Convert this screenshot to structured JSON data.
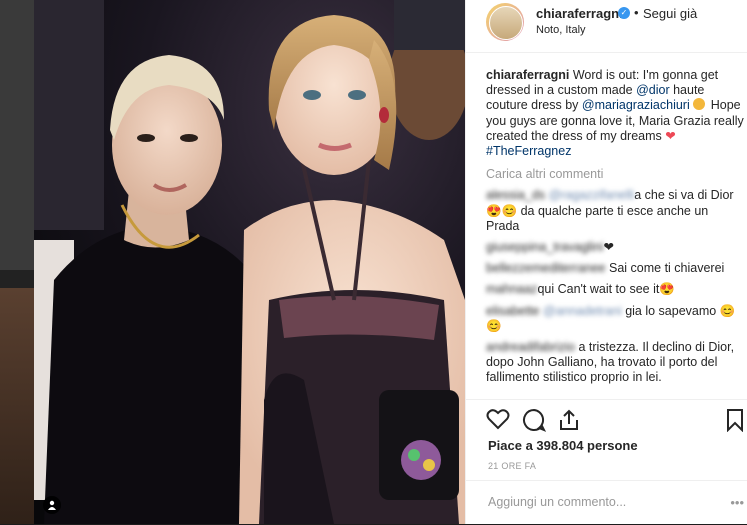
{
  "post": {
    "username": "chiaraferragni",
    "follow_label": "Segui già",
    "separator": "•",
    "location": "Noto, Italy"
  },
  "caption": {
    "user": "chiaraferragni",
    "text_before": " Word is out: I'm gonna get dressed in a custom made ",
    "mention1": "@dior",
    "text_mid": " haute couture dress by ",
    "mention2": "@mariagraziachiuri",
    "text_after": " Hope you guys are gonna love it, Maria Grazia really created the dress of my dreams ",
    "hashtag": "#TheFerragnez"
  },
  "load_more": "Carica altri commenti",
  "comments": [
    {
      "user": "alessia_ds",
      "mention": "@ragazzifanelli",
      "text": "a che si va di Dior 😍😊 da qualche parte ti esce anche un Prada"
    },
    {
      "user": "giuseppina_travaglini",
      "mention": "",
      "text": "❤"
    },
    {
      "user": "bellezzemediterranee",
      "mention": "",
      "text": "Sai come ti chiaverei"
    },
    {
      "user": "mahnaaz",
      "mention": "",
      "text": "qui Can't wait to see it😍"
    },
    {
      "user": "elisabette",
      "mention": "@annadetrani",
      "text": "gia lo sapevamo 😊😊"
    },
    {
      "user": "andreadifabrizio",
      "mention": "",
      "text": "a tristezza. Il declino di Dior, dopo John Galliano, ha trovato il porto del fallimento stilistico proprio in lei."
    }
  ],
  "likes_text": "Piace a 398.804 persone",
  "timestamp": "21 ORE FA",
  "add_comment_placeholder": "Aggiungi un commento...",
  "more_label": "•••",
  "colors": {
    "link": "#003569",
    "verified": "#3897f0",
    "heart": "#ed4956"
  },
  "icons": [
    "heart-icon",
    "comment-icon",
    "share-icon",
    "bookmark-icon",
    "verified-badge-icon",
    "user-tag-icon"
  ]
}
